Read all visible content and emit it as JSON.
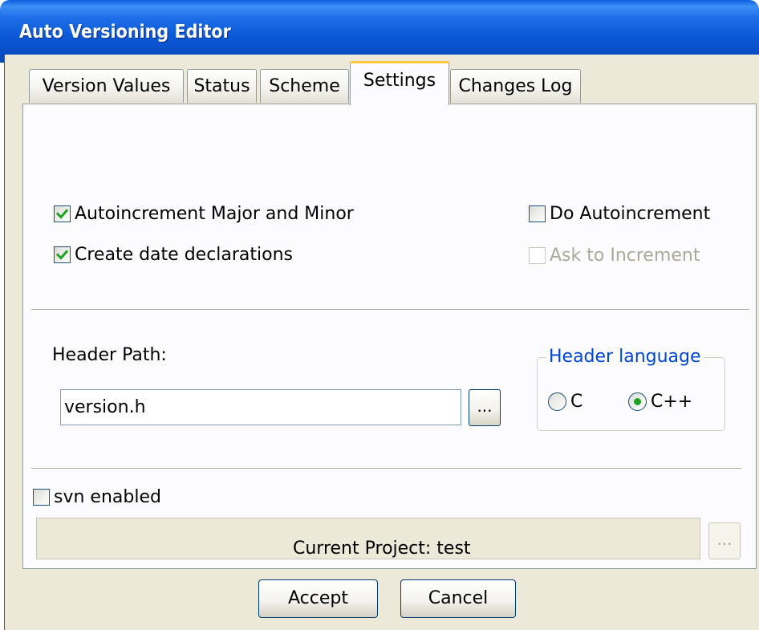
{
  "window": {
    "title": "Auto Versioning Editor"
  },
  "tabs": [
    {
      "label": "Version Values"
    },
    {
      "label": "Status"
    },
    {
      "label": "Scheme"
    },
    {
      "label": "Settings",
      "active": true
    },
    {
      "label": "Changes Log"
    }
  ],
  "settings": {
    "autoincrement_major_minor": {
      "label": "Autoincrement Major and Minor",
      "checked": true
    },
    "create_date_declarations": {
      "label": "Create date declarations",
      "checked": true
    },
    "do_autoincrement": {
      "label": "Do Autoincrement",
      "checked": false
    },
    "ask_to_increment": {
      "label": "Ask to Increment",
      "checked": false,
      "enabled": false
    },
    "header_path": {
      "label": "Header Path:",
      "value": "version.h",
      "browse_label": "..."
    },
    "header_language": {
      "title": "Header language",
      "options": [
        {
          "label": "C",
          "selected": false
        },
        {
          "label": "C++",
          "selected": true
        }
      ]
    },
    "svn": {
      "label": "svn enabled",
      "checked": false,
      "path_value": "",
      "browse_label": "..."
    }
  },
  "footer": {
    "current_project": "Current Project: test",
    "accept_label": "Accept",
    "cancel_label": "Cancel"
  },
  "colors": {
    "titlebar": "#0a57d8",
    "dialog_bg": "#ece9d8",
    "panel_bg": "#fcfcfe",
    "active_tab_accent": "#ffc83c",
    "check_mark": "#21a121",
    "group_title": "#0046d5",
    "disabled_text": "#aca899"
  }
}
